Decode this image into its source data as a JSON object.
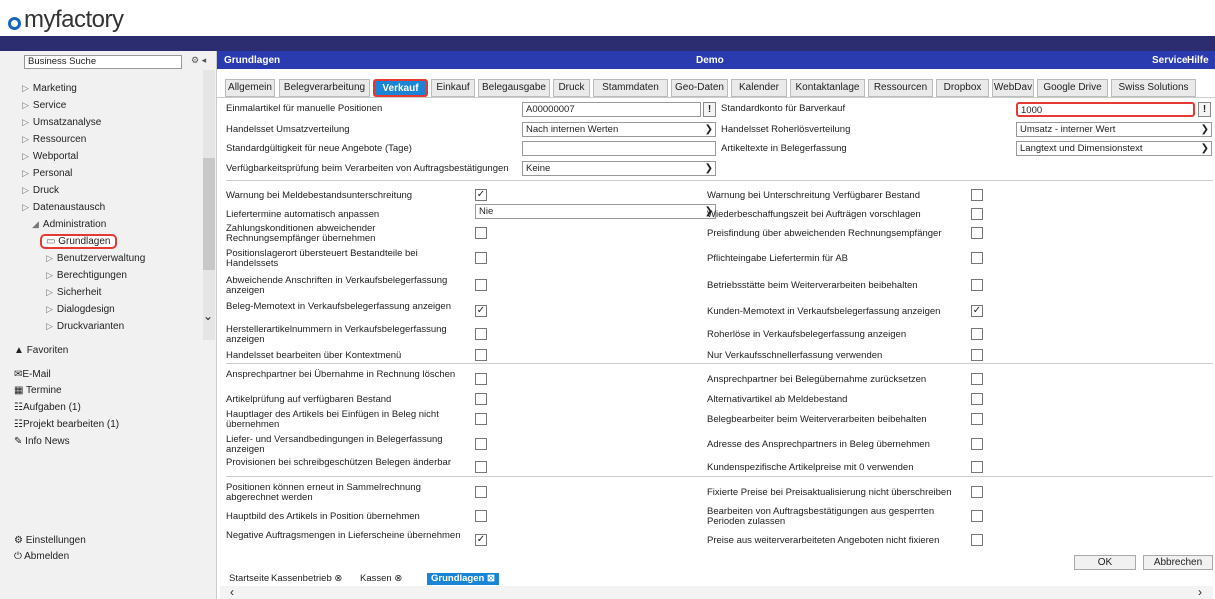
{
  "brand": {
    "logo_text": "myfactory",
    "accent": "#1565c0"
  },
  "header": {
    "title": "Grundlagen",
    "center": "Demo",
    "service": "Service",
    "hilfe": "Hilfe"
  },
  "sidebar": {
    "search_value": "Business Suche",
    "items": [
      {
        "label": "Marketing"
      },
      {
        "label": "Service"
      },
      {
        "label": "Umsatzanalyse"
      },
      {
        "label": "Ressourcen"
      },
      {
        "label": "Webportal"
      },
      {
        "label": "Personal"
      },
      {
        "label": "Druck"
      },
      {
        "label": "Datenaustausch"
      },
      {
        "label": "Administration"
      }
    ],
    "sub": [
      {
        "label": "Grundlagen"
      },
      {
        "label": "Benutzerverwaltung"
      },
      {
        "label": "Berechtigungen"
      },
      {
        "label": "Sicherheit"
      },
      {
        "label": "Dialogdesign"
      },
      {
        "label": "Druckvarianten"
      }
    ],
    "favorites": "Favoriten",
    "links": [
      "E-Mail",
      "Termine",
      "Aufgaben (1)",
      "Projekt bearbeiten (1)",
      "Info News"
    ],
    "settings": "Einstellungen",
    "logout": "Abmelden"
  },
  "tabs": [
    "Allgemein",
    "Belegverarbeitung",
    "Verkauf",
    "Einkauf",
    "Belegausgabe",
    "Druck",
    "Stammdaten",
    "Geo-Daten",
    "Kalender",
    "Kontaktanlage",
    "Ressourcen",
    "Dropbox",
    "WebDav",
    "Google Drive",
    "Swiss Solutions"
  ],
  "active_tab": "Verkauf",
  "form": {
    "einmalartikel_label": "Einmalartikel für manuelle Positionen",
    "einmalartikel_value": "A00000007",
    "standardkonto_label": "Standardkonto für Barverkauf",
    "standardkonto_value": "1000",
    "handelsset_umsatz_label": "Handelsset Umsatzverteilung",
    "handelsset_umsatz_value": "Nach internen Werten",
    "handelsset_roherl_label": "Handelsset Roherlösverteilung",
    "handelsset_roherl_value": "Umsatz - interner Wert",
    "standardgueltigkeit_label": "Standardgültigkeit für neue Angebote (Tage)",
    "artikeltexte_label": "Artikeltexte in Belegerfassung",
    "artikeltexte_value": "Langtext und Dimensionstext",
    "verfuegbarkeit_label": "Verfügbarkeitsprüfung beim Verarbeiten von Auftragsbestätigungen",
    "verfuegbarkeit_value": "Keine",
    "liefertermine_value": "Nie"
  },
  "checks_left": [
    {
      "label": "Warnung bei Meldebestandsunterschreitung",
      "checked": true
    },
    {
      "label": "Liefertermine automatisch anpassen",
      "checked": null
    },
    {
      "label": "Zahlungskonditionen abweichender Rechnungsempfänger übernehmen",
      "checked": false
    },
    {
      "label": "Positionslagerort übersteuert Bestandteile bei Handelssets",
      "checked": false
    },
    {
      "label": "Abweichende Anschriften in Verkaufsbelegerfassung anzeigen",
      "checked": false
    },
    {
      "label": "Beleg-Memotext in Verkaufsbelegerfassung anzeigen",
      "checked": true
    },
    {
      "label": "Herstellerartikelnummern in Verkaufsbelegerfassung anzeigen",
      "checked": false
    },
    {
      "label": "Handelsset bearbeiten über Kontextmenü",
      "checked": false
    },
    {
      "label": "Ansprechpartner bei Übernahme in Rechnung löschen",
      "checked": false
    },
    {
      "label": "Artikelprüfung auf verfügbaren Bestand",
      "checked": false
    },
    {
      "label": "Hauptlager des Artikels bei Einfügen in Beleg nicht übernehmen",
      "checked": false
    },
    {
      "label": "Liefer- und Versandbedingungen in Belegerfassung anzeigen",
      "checked": false
    },
    {
      "label": "Provisionen bei schreibgeschützen Belegen änderbar",
      "checked": false
    },
    {
      "label": "Positionen können erneut in Sammelrechnung abgerechnet werden",
      "checked": false
    },
    {
      "label": "Hauptbild des Artikels in Position übernehmen",
      "checked": false
    },
    {
      "label": "Negative Auftragsmengen in Lieferscheine übernehmen",
      "checked": true
    }
  ],
  "checks_right": [
    {
      "label": "Warnung bei Unterschreitung Verfügbarer Bestand",
      "checked": false
    },
    {
      "label": "Wiederbeschaffungszeit bei Aufträgen vorschlagen",
      "checked": false
    },
    {
      "label": "Preisfindung über abweichenden Rechnungsempfänger",
      "checked": false
    },
    {
      "label": "Pflichteingabe Liefertermin für AB",
      "checked": false
    },
    {
      "label": "Betriebsstätte beim Weiterverarbeiten beibehalten",
      "checked": false
    },
    {
      "label": "Kunden-Memotext in Verkaufsbelegerfassung anzeigen",
      "checked": true
    },
    {
      "label": "Roherlöse in Verkaufsbelegerfassung anzeigen",
      "checked": false
    },
    {
      "label": "Nur Verkaufsschnellerfassung verwenden",
      "checked": false
    },
    {
      "label": "Ansprechpartner bei Belegübernahme zurücksetzen",
      "checked": false
    },
    {
      "label": "Alternativartikel ab Meldebestand",
      "checked": false
    },
    {
      "label": "Belegbearbeiter beim Weiterverarbeiten beibehalten",
      "checked": false
    },
    {
      "label": "Adresse des Ansprechpartners in Beleg übernehmen",
      "checked": false
    },
    {
      "label": "Kundenspezifische Artikelpreise mit 0 verwenden",
      "checked": false
    },
    {
      "label": "Fixierte Preise bei Preisaktualisierung nicht überschreiben",
      "checked": false
    },
    {
      "label": "Bearbeiten von Auftragsbestätigungen aus gesperrten Perioden zulassen",
      "checked": false
    },
    {
      "label": "Preise aus weiterverarbeiteten Angeboten nicht fixieren",
      "checked": false
    }
  ],
  "buttons": {
    "ok": "OK",
    "cancel": "Abbrechen"
  },
  "bottom_tabs": [
    "Startseite",
    "Kassenbetrieb",
    "Kassen",
    "Grundlagen"
  ]
}
